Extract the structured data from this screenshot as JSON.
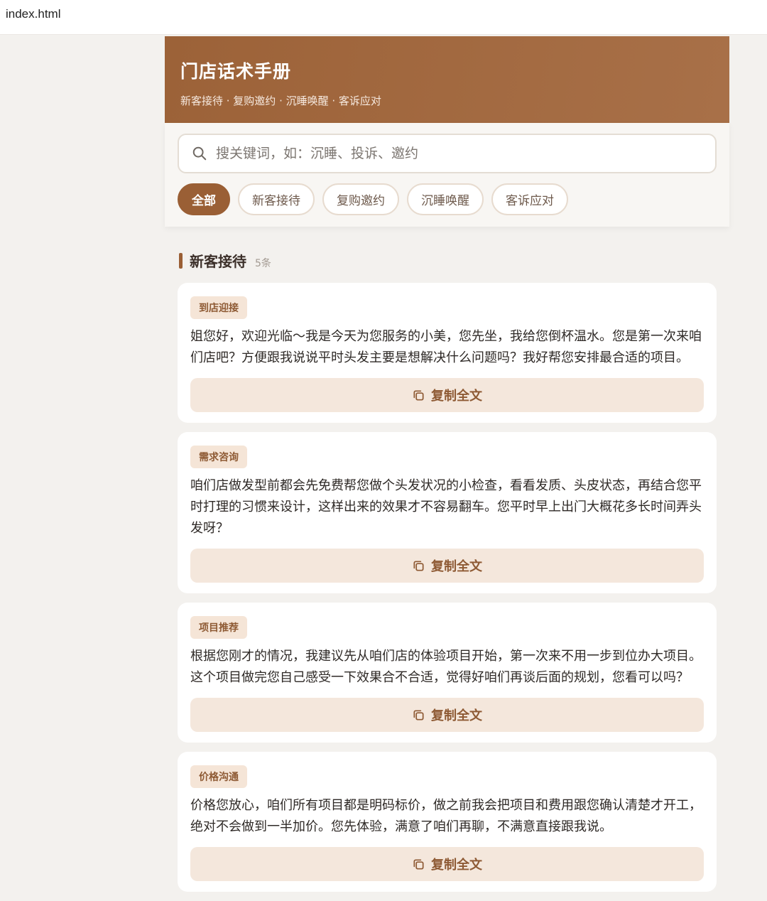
{
  "window": {
    "filename": "index.html"
  },
  "header": {
    "title": "门店话术手册",
    "subtitle": "新客接待 · 复购邀约 · 沉睡唤醒 · 客诉应对"
  },
  "search": {
    "placeholder": "搜关键词，如：沉睡、投诉、邀约",
    "value": ""
  },
  "filters": [
    {
      "label": "全部",
      "active": true
    },
    {
      "label": "新客接待",
      "active": false
    },
    {
      "label": "复购邀约",
      "active": false
    },
    {
      "label": "沉睡唤醒",
      "active": false
    },
    {
      "label": "客诉应对",
      "active": false
    }
  ],
  "section": {
    "title": "新客接待",
    "count": "5条"
  },
  "cards": [
    {
      "tag": "到店迎接",
      "text": "姐您好，欢迎光临～我是今天为您服务的小美，您先坐，我给您倒杯温水。您是第一次来咱们店吧？方便跟我说说平时头发主要是想解决什么问题吗？我好帮您安排最合适的项目。",
      "copy_label": "复制全文"
    },
    {
      "tag": "需求咨询",
      "text": "咱们店做发型前都会先免费帮您做个头发状况的小检查，看看发质、头皮状态，再结合您平时打理的习惯来设计，这样出来的效果才不容易翻车。您平时早上出门大概花多长时间弄头发呀？",
      "copy_label": "复制全文"
    },
    {
      "tag": "项目推荐",
      "text": "根据您刚才的情况，我建议先从咱们店的体验项目开始，第一次来不用一步到位办大项目。这个项目做完您自己感受一下效果合不合适，觉得好咱们再谈后面的规划，您看可以吗？",
      "copy_label": "复制全文"
    },
    {
      "tag": "价格沟通",
      "text": "价格您放心，咱们所有项目都是明码标价，做之前我会把项目和费用跟您确认清楚才开工，绝对不会做到一半加价。您先体验，满意了咱们再聊，不满意直接跟我说。",
      "copy_label": "复制全文"
    }
  ],
  "colors": {
    "accent": "#9a5f35",
    "header": "#a06640",
    "tag_bg": "#f5e5d7"
  }
}
